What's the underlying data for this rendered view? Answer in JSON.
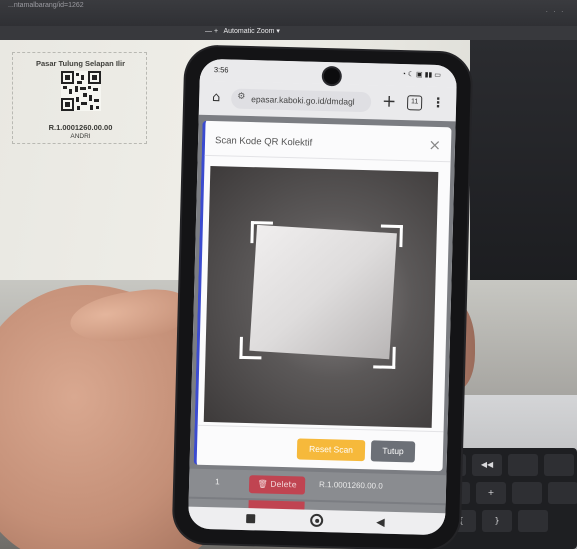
{
  "pdf_viewer": {
    "url_fragment": "...ntamalbarang/id=1262",
    "zoom_label": "Automatic Zoom",
    "zoom_controls": "—  +",
    "top_right": "..."
  },
  "label_card": {
    "market_name": "Pasar Tulung Selapan Ilir",
    "code": "R.1.0001260.00.00",
    "owner": "ANDRI"
  },
  "phone": {
    "status_time": "3:56",
    "status_icons": "◔ ☾ ▣ ▮▮ ▭",
    "browser": {
      "url": "epasar.kaboki.go.id/dmdagl",
      "tabs_count": "11"
    },
    "modal": {
      "title": "Scan Kode QR Kolektif",
      "close_symbol": "×",
      "reset_button": "Reset Scan",
      "close_button": "Tutup"
    },
    "table": {
      "row_number": "1",
      "delete_label": "🗑 Delete",
      "row_code": "R.1.0001260.00.0"
    }
  },
  "keyboard": {
    "keys": [
      "✧",
      "◀◀",
      "—",
      "+",
      "{",
      "}"
    ]
  },
  "colors": {
    "reset_button": "#f6b93b",
    "close_button": "#6c7077",
    "delete_button": "#c04451",
    "modal_accent": "#3b4bd0"
  }
}
